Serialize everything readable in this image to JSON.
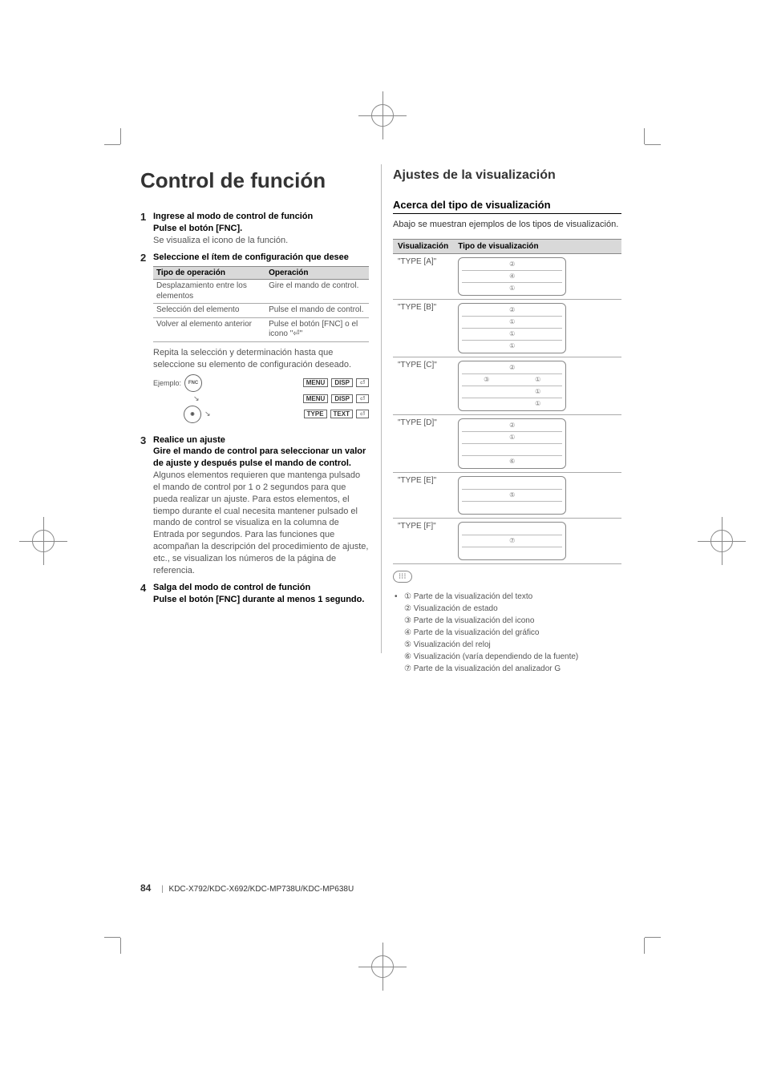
{
  "title": "Control de función",
  "right_title": "Ajustes de la visualización",
  "right_subheading": "Acerca del tipo de visualización",
  "right_lead": "Abajo se muestran ejemplos de los tipos de visualización.",
  "steps": [
    {
      "num": "1",
      "title": "Ingrese al modo de control de función",
      "line2": "Pulse el botón [FNC].",
      "text": "Se visualiza el icono de la función."
    },
    {
      "num": "2",
      "title": "Seleccione el ítem de configuración que desee"
    },
    {
      "num": "3",
      "title": "Realice un ajuste",
      "line2": "Gire el mando de control para seleccionar un valor de ajuste y después pulse el mando de control.",
      "text": "Algunos elementos requieren que mantenga pulsado el mando de control por 1 o 2 segundos para que pueda realizar un ajuste. Para estos elementos, el tiempo durante el cual necesita mantener pulsado el mando de control se visualiza en la columna de Entrada por segundos.  Para las funciones que acompañan la descripción del procedimiento de ajuste, etc., se visualizan los números de la página de referencia."
    },
    {
      "num": "4",
      "title": "Salga del modo de control de función",
      "line2": "Pulse el botón [FNC] durante al menos 1 segundo."
    }
  ],
  "op_table": {
    "headers": [
      "Tipo de operación",
      "Operación"
    ],
    "rows": [
      [
        "Desplazamiento entre los elementos",
        "Gire el mando de control."
      ],
      [
        "Selección del elemento",
        "Pulse el mando de control."
      ],
      [
        "Volver al elemento anterior",
        "Pulse el botón [FNC] o el icono \"⏎\""
      ]
    ]
  },
  "after_table_text": "Repita la selección y determinación hasta que seleccione su elemento de configuración deseado.",
  "example_label": "Ejemplo:",
  "example": {
    "knob1": "FNC",
    "row1": [
      "MENU",
      "DISP",
      "⏎"
    ],
    "row2": [
      "MENU",
      "DISP",
      "⏎"
    ],
    "row3": [
      "TYPE",
      "TEXT",
      "⏎"
    ]
  },
  "vis_table": {
    "headers": [
      "Visualización",
      "Tipo de visualización"
    ],
    "rows": [
      {
        "label": "\"TYPE [A]\"",
        "cells": [
          [
            "②"
          ],
          [
            "④"
          ],
          [
            "①"
          ]
        ]
      },
      {
        "label": "\"TYPE [B]\"",
        "cells": [
          [
            "②"
          ],
          [
            "①"
          ],
          [
            "①"
          ],
          [
            "①"
          ]
        ]
      },
      {
        "label": "\"TYPE [C]\"",
        "cells": [
          [
            "②"
          ],
          [
            "③",
            "①"
          ],
          [
            "",
            "①"
          ],
          [
            "",
            "①"
          ]
        ]
      },
      {
        "label": "\"TYPE [D]\"",
        "cells": [
          [
            "②"
          ],
          [
            "①"
          ],
          [
            ""
          ],
          [
            "⑥"
          ]
        ]
      },
      {
        "label": "\"TYPE [E]\"",
        "cells": [
          [
            ""
          ],
          [
            "⑤"
          ],
          [
            ""
          ]
        ]
      },
      {
        "label": "\"TYPE [F]\"",
        "cells": [
          [
            ""
          ],
          [
            "⑦"
          ],
          [
            ""
          ]
        ]
      }
    ]
  },
  "legend": [
    "① Parte de la visualización del texto",
    "② Visualización de estado",
    "③ Parte de la visualización del icono",
    "④ Parte de la visualización del gráfico",
    "⑤ Visualización del reloj",
    "⑥ Visualización (varía dependiendo de la fuente)",
    "⑦ Parte de la visualización del analizador G"
  ],
  "footer": {
    "page": "84",
    "models": "KDC-X792/KDC-X692/KDC-MP738U/KDC-MP638U"
  }
}
